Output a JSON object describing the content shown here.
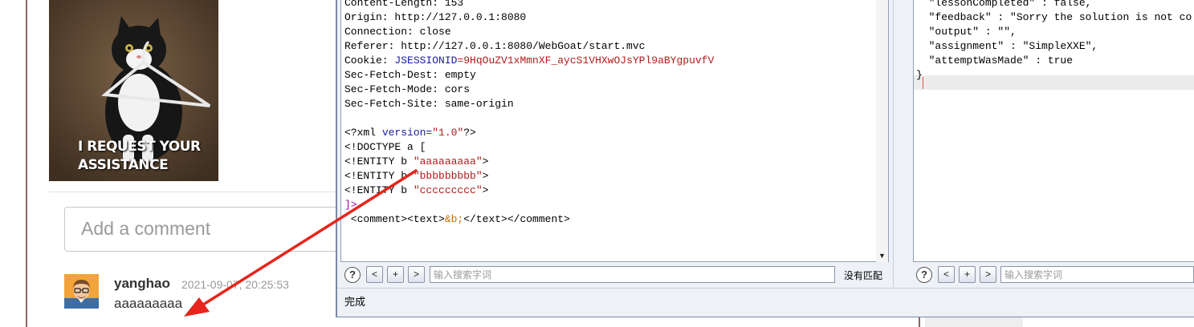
{
  "webgoat": {
    "image_caption_line1": "I REQUEST YOUR",
    "image_caption_line2": "ASSISTANCE",
    "comment_placeholder": "Add a comment",
    "comment": {
      "user": "yanghao",
      "date": "2021-09-07, 20:25:53",
      "text": "aaaaaaaaa"
    }
  },
  "request": {
    "headers": [
      "Content-Length: 153",
      "Origin: http://127.0.0.1:8080",
      "Connection: close",
      "Referer: http://127.0.0.1:8080/WebGoat/start.mvc"
    ],
    "cookie_label": "Cookie: ",
    "cookie_name": "JSESSIONID",
    "cookie_value": "=9HqOuZV1xMmnXF_aycS1VHXwOJsYPl9aBYgpuvfV",
    "headers2": [
      "Sec-Fetch-Dest: empty",
      "Sec-Fetch-Mode: cors",
      "Sec-Fetch-Site: same-origin"
    ],
    "xml_decl_start": "<?xml ",
    "xml_decl_attr": "version=",
    "xml_decl_val": "\"1.0\"",
    "xml_decl_end": "?>",
    "doctype": "<!DOCTYPE a [",
    "entities": [
      {
        "prefix": "<!ENTITY b ",
        "value": "\"aaaaaaaaa\"",
        "suffix": ">"
      },
      {
        "prefix": "<!ENTITY b ",
        "value": "\"bbbbbbbbb\"",
        "suffix": ">"
      },
      {
        "prefix": "<!ENTITY b ",
        "value": "\"ccccccccc\"",
        "suffix": ">"
      }
    ],
    "doctype_close": "]>",
    "body_start": " <comment><text>",
    "body_entity": "&b;",
    "body_end": "</text></comment>"
  },
  "response": {
    "lines": [
      "  \"lessonCompleted\" : false,",
      "  \"feedback\" : \"Sorry the solution is not co",
      "  \"output\" : \"\",",
      "  \"assignment\" : \"SimpleXXE\",",
      "  \"attemptWasMade\" : true",
      "}"
    ]
  },
  "search": {
    "help": "?",
    "prev": "<",
    "add": "+",
    "next": ">",
    "placeholder": "输入搜索字词",
    "no_match": "没有匹配"
  },
  "status": {
    "text": "完成"
  },
  "colors": {
    "annotation_arrow": "#e8241c",
    "border_accent": "#8a6464"
  }
}
